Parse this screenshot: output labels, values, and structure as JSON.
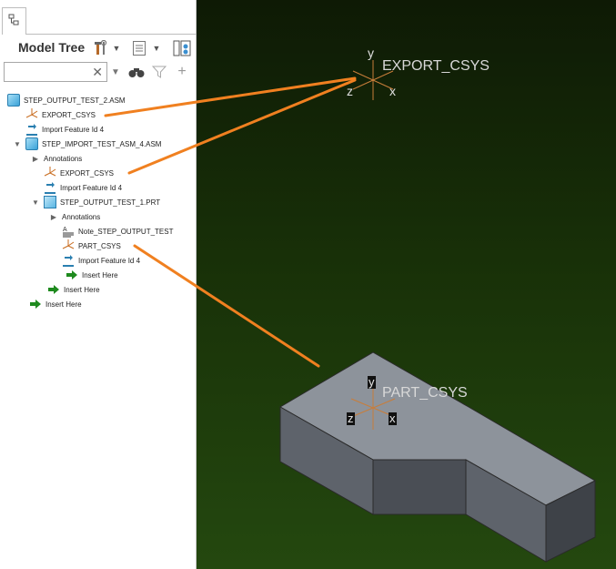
{
  "panel": {
    "title": "Model Tree",
    "search_placeholder": ""
  },
  "tree": [
    {
      "label": "STEP_OUTPUT_TEST_2.ASM",
      "icon": "assembly-icon"
    },
    {
      "label": "EXPORT_CSYS",
      "icon": "csys-icon"
    },
    {
      "label": "Import Feature Id 4",
      "icon": "import-feature-icon"
    },
    {
      "label": "STEP_IMPORT_TEST_ASM_4.ASM",
      "icon": "assembly-icon"
    },
    {
      "label": "Annotations",
      "icon": "expand-caret-icon"
    },
    {
      "label": "EXPORT_CSYS",
      "icon": "csys-icon"
    },
    {
      "label": "Import Feature Id 4",
      "icon": "import-feature-icon"
    },
    {
      "label": "STEP_OUTPUT_TEST_1.PRT",
      "icon": "part-icon"
    },
    {
      "label": "Annotations",
      "icon": "expand-caret-icon"
    },
    {
      "label": "Note_STEP_OUTPUT_TEST",
      "icon": "note-icon"
    },
    {
      "label": "PART_CSYS",
      "icon": "csys-icon"
    },
    {
      "label": "Import Feature Id 4",
      "icon": "import-feature-icon"
    },
    {
      "label": "Insert Here",
      "icon": "insert-arrow-icon"
    },
    {
      "label": "Insert Here",
      "icon": "insert-arrow-icon"
    },
    {
      "label": "Insert Here",
      "icon": "insert-arrow-icon"
    }
  ],
  "viewport": {
    "export_csys": {
      "label": "EXPORT_CSYS",
      "x": "x",
      "y": "y",
      "z": "z"
    },
    "part_csys": {
      "label": "PART_CSYS",
      "x": "x",
      "y": "y",
      "z": "z"
    }
  },
  "colors": {
    "annotation_line": "#f08020",
    "csys_lines": "#c87d3a",
    "part_face": "#8d939b",
    "viewport_bg_top": "#0e1a05",
    "viewport_bg_bottom": "#24480f"
  }
}
